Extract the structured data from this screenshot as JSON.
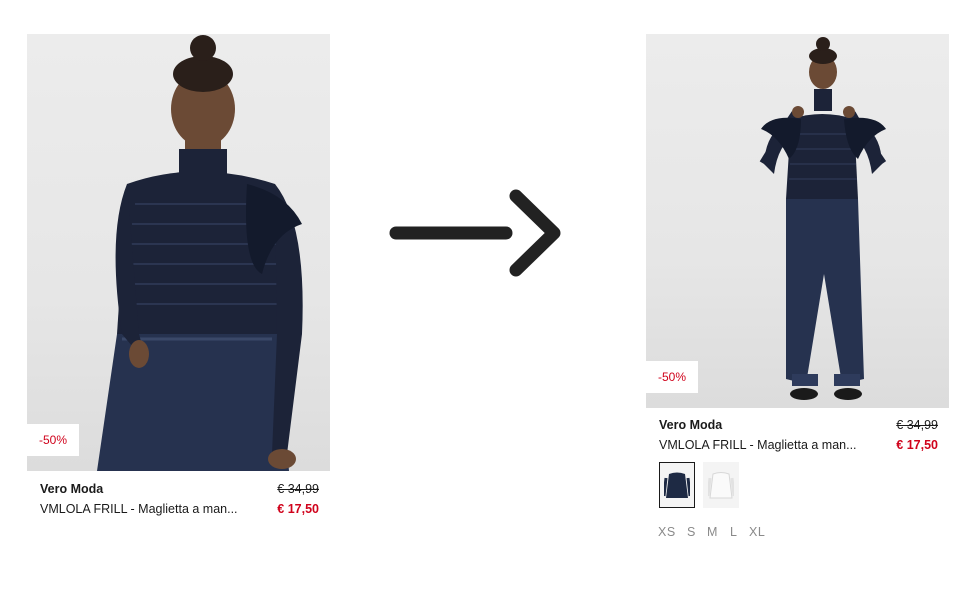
{
  "left_card": {
    "badge": "-50%",
    "brand": "Vero Moda",
    "name": "VMLOLA FRILL - Maglietta a man...",
    "old_price": "€ 34,99",
    "new_price": "€ 17,50"
  },
  "transition": {
    "icon": "arrow-right-icon"
  },
  "right_card": {
    "badge": "-50%",
    "brand": "Vero Moda",
    "name": "VMLOLA FRILL - Maglietta a man...",
    "old_price": "€ 34,99",
    "new_price": "€ 17,50",
    "color_swatches": [
      "navy",
      "white"
    ],
    "sizes": [
      "XS",
      "S",
      "M",
      "L",
      "XL"
    ]
  },
  "colors": {
    "sale_red": "#d0021b",
    "navy": "#1e2a44",
    "photo_bg": "#e8e8e8"
  }
}
